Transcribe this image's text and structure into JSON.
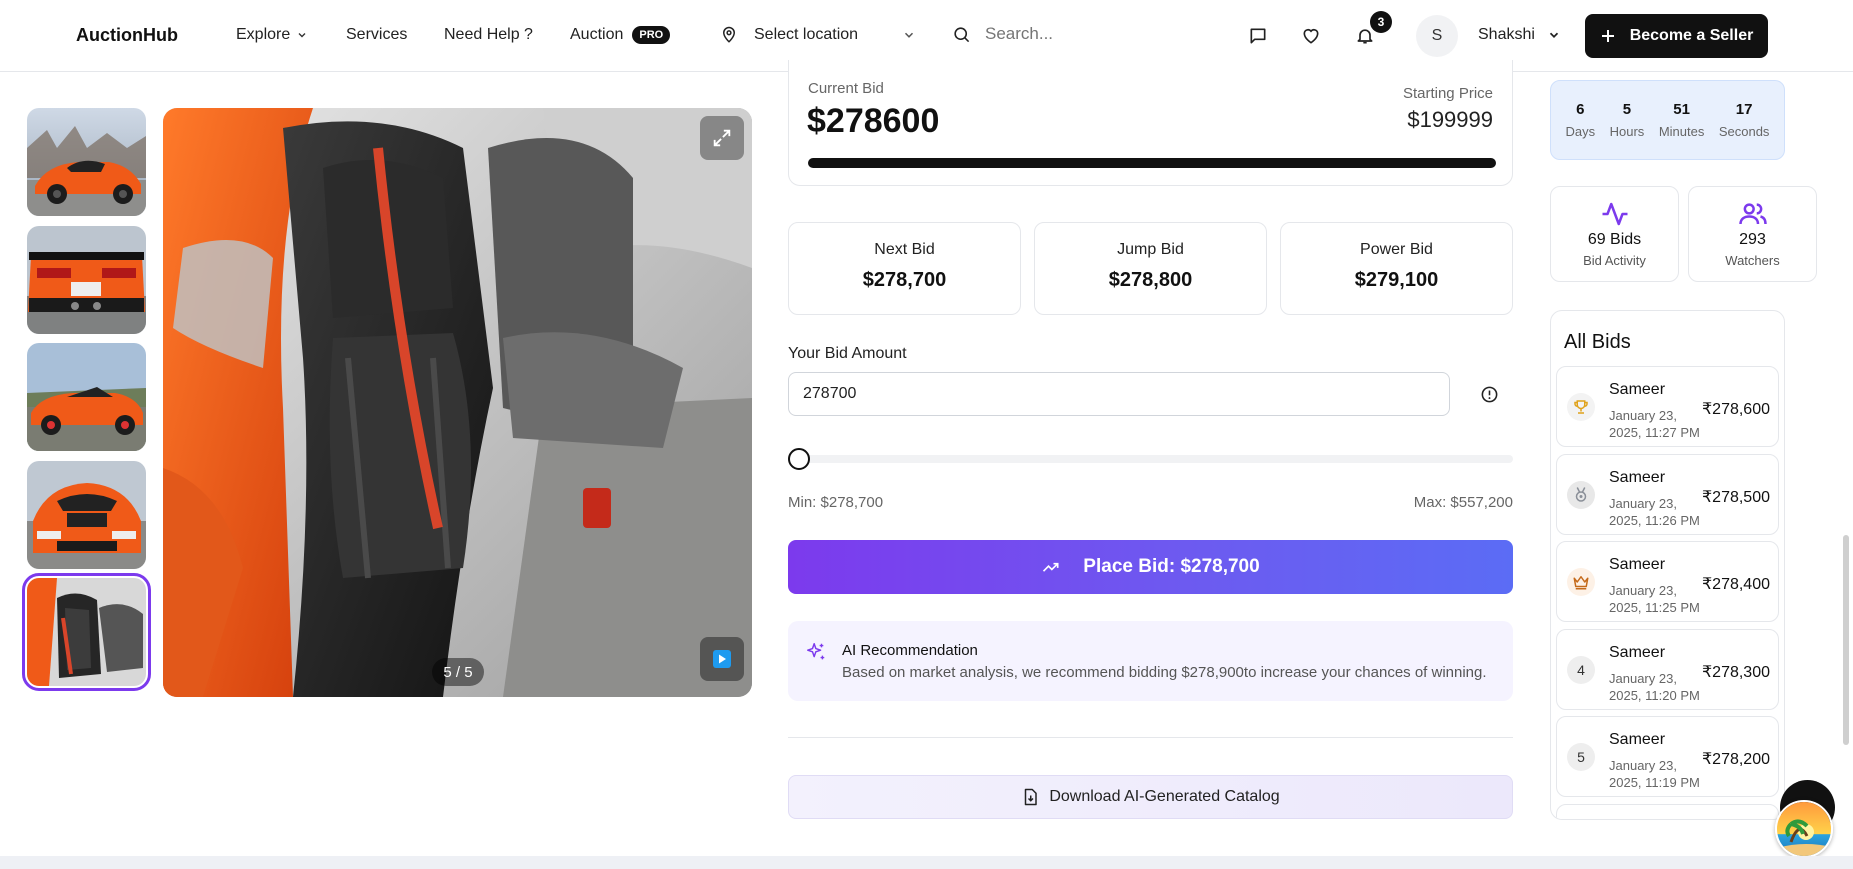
{
  "header": {
    "logo": "AuctionHub",
    "nav": {
      "explore": "Explore",
      "services": "Services",
      "need_help": "Need Help ?",
      "auction": "Auction",
      "pro_badge": "PRO"
    },
    "location": "Select location",
    "search_placeholder": "Search...",
    "notification_count": "3",
    "user_initial": "S",
    "user_name": "Shakshi",
    "seller_button": "Become a Seller"
  },
  "gallery": {
    "counter": "5 / 5",
    "selected_thumbnail": 5,
    "thumbnail_count": 5
  },
  "bid_summary": {
    "current_bid_label": "Current Bid",
    "current_bid": "$278600",
    "starting_price_label": "Starting Price",
    "starting_price": "$199999"
  },
  "bid_options": [
    {
      "label": "Next Bid",
      "value": "$278,700"
    },
    {
      "label": "Jump Bid",
      "value": "$278,800"
    },
    {
      "label": "Power Bid",
      "value": "$279,100"
    }
  ],
  "bid_input": {
    "label": "Your Bid Amount",
    "value": "278700",
    "min_label": "Min: $278,700",
    "max_label": "Max: $557,200",
    "slider_fraction": 0
  },
  "place_bid_label": "Place Bid: $278,700",
  "ai_recommendation": {
    "title": "AI Recommendation",
    "text": "Based on market analysis, we recommend bidding $278,900to increase your chances of winning."
  },
  "download_label": "Download AI-Generated Catalog",
  "countdown": [
    {
      "value": "6",
      "unit": "Days"
    },
    {
      "value": "5",
      "unit": "Hours"
    },
    {
      "value": "51",
      "unit": "Minutes"
    },
    {
      "value": "17",
      "unit": "Seconds"
    }
  ],
  "stats": {
    "bids_value": "69 Bids",
    "bids_label": "Bid Activity",
    "watchers_value": "293",
    "watchers_label": "Watchers"
  },
  "all_bids": {
    "title": "All Bids",
    "rows": [
      {
        "rank": "trophy",
        "name": "Sameer",
        "date": "January 23, 2025, 11:27 PM",
        "amount": "₹278,600"
      },
      {
        "rank": "medal",
        "name": "Sameer",
        "date": "January 23, 2025, 11:26 PM",
        "amount": "₹278,500"
      },
      {
        "rank": "crown",
        "name": "Sameer",
        "date": "January 23, 2025, 11:25 PM",
        "amount": "₹278,400"
      },
      {
        "rank": "4",
        "name": "Sameer",
        "date": "January 23, 2025, 11:20 PM",
        "amount": "₹278,300"
      },
      {
        "rank": "5",
        "name": "Sameer",
        "date": "January 23, 2025, 11:19 PM",
        "amount": "₹278,200"
      }
    ]
  },
  "colors": {
    "accent": "#7c3aed",
    "button_gradient_end": "#5b6cf5",
    "timer_bg": "#e8f0fd",
    "car_orange": "#f05a18"
  }
}
